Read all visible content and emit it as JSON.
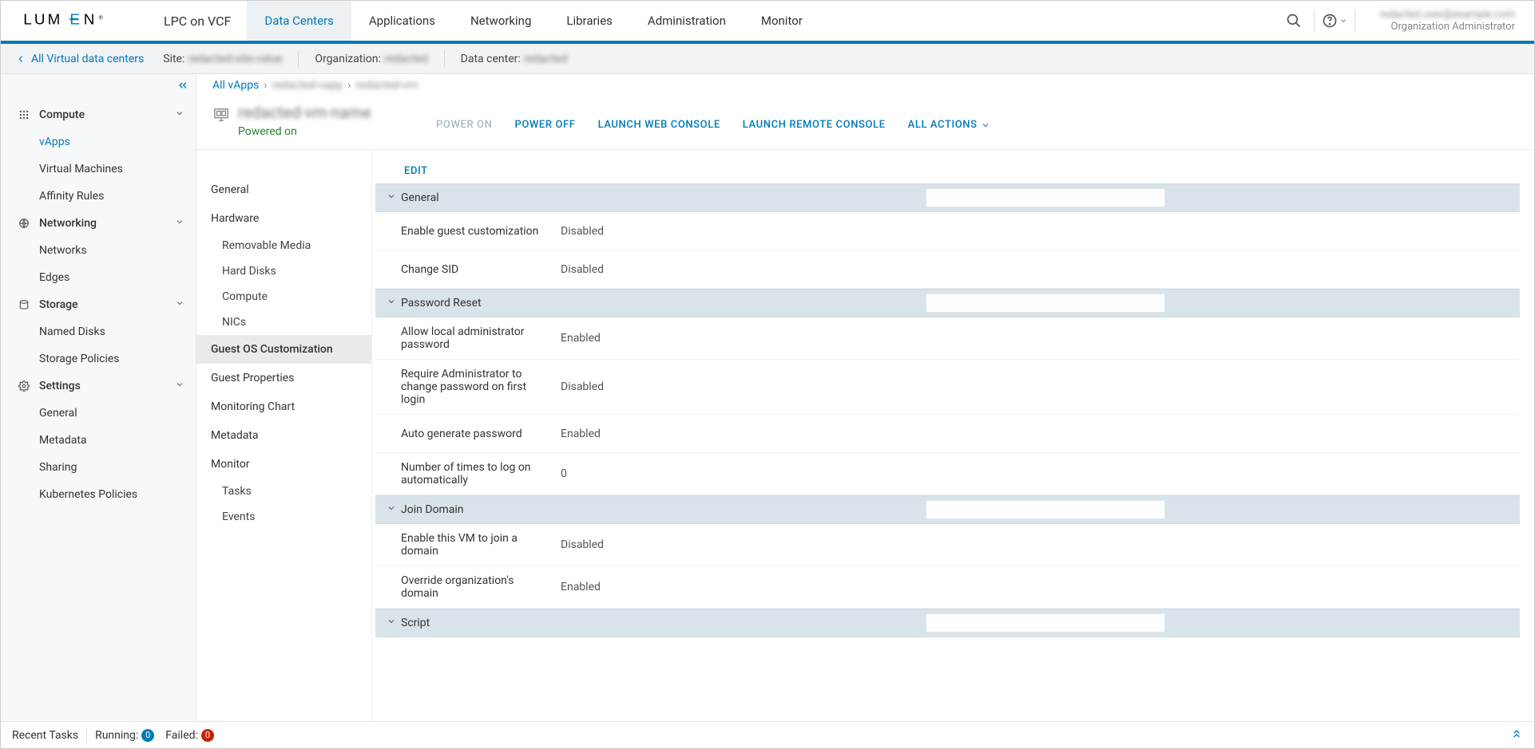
{
  "header": {
    "logo_text": "LUMEN",
    "product_name": "LPC on VCF",
    "nav": [
      "Data Centers",
      "Applications",
      "Networking",
      "Libraries",
      "Administration",
      "Monitor"
    ],
    "active_nav_index": 0,
    "user_email": "redacted.user@example.com",
    "user_role": "Organization Administrator"
  },
  "context_bar": {
    "back_label": "All Virtual data centers",
    "site_label": "Site:",
    "site_value": "redacted-site-value",
    "org_label": "Organization:",
    "org_value": "redacted",
    "dc_label": "Data center:",
    "dc_value": "redacted"
  },
  "sidebar": {
    "sections": [
      {
        "title": "Compute",
        "icon": "grid",
        "items": [
          "vApps",
          "Virtual Machines",
          "Affinity Rules"
        ],
        "active_item": "vApps"
      },
      {
        "title": "Networking",
        "icon": "network",
        "items": [
          "Networks",
          "Edges"
        ]
      },
      {
        "title": "Storage",
        "icon": "storage",
        "items": [
          "Named Disks",
          "Storage Policies"
        ]
      },
      {
        "title": "Settings",
        "icon": "gear",
        "items": [
          "General",
          "Metadata",
          "Sharing",
          "Kubernetes Policies"
        ]
      }
    ]
  },
  "breadcrumb": {
    "root": "All vApps",
    "level1": "redacted-vapp",
    "level2": "redacted-vm"
  },
  "vm": {
    "name": "redacted-vm-name",
    "status": "Powered on"
  },
  "actions": {
    "power_on": "POWER ON",
    "power_off": "POWER OFF",
    "launch_web": "LAUNCH WEB CONSOLE",
    "launch_remote": "LAUNCH REMOTE CONSOLE",
    "all_actions": "ALL ACTIONS"
  },
  "detail_nav": {
    "items": [
      {
        "label": "General",
        "type": "item"
      },
      {
        "label": "Hardware",
        "type": "item"
      },
      {
        "label": "Removable Media",
        "type": "sub"
      },
      {
        "label": "Hard Disks",
        "type": "sub"
      },
      {
        "label": "Compute",
        "type": "sub"
      },
      {
        "label": "NICs",
        "type": "sub"
      },
      {
        "label": "Guest OS Customization",
        "type": "item",
        "active": true
      },
      {
        "label": "Guest Properties",
        "type": "item"
      },
      {
        "label": "Monitoring Chart",
        "type": "item"
      },
      {
        "label": "Metadata",
        "type": "item"
      },
      {
        "label": "Monitor",
        "type": "item"
      },
      {
        "label": "Tasks",
        "type": "sub"
      },
      {
        "label": "Events",
        "type": "sub"
      }
    ]
  },
  "edit_label": "EDIT",
  "sections": [
    {
      "title": "General",
      "rows": [
        {
          "label": "Enable guest customization",
          "value": "Disabled"
        },
        {
          "label": "Change SID",
          "value": "Disabled"
        }
      ]
    },
    {
      "title": "Password Reset",
      "rows": [
        {
          "label": "Allow local administrator password",
          "value": "Enabled"
        },
        {
          "label": "Require Administrator to change password on first login",
          "value": "Disabled"
        },
        {
          "label": "Auto generate password",
          "value": "Enabled"
        },
        {
          "label": "Number of times to log on automatically",
          "value": "0"
        }
      ]
    },
    {
      "title": "Join Domain",
      "rows": [
        {
          "label": "Enable this VM to join a domain",
          "value": "Disabled"
        },
        {
          "label": "Override organization's domain",
          "value": "Enabled"
        }
      ]
    },
    {
      "title": "Script",
      "rows": []
    }
  ],
  "footer": {
    "recent_tasks": "Recent Tasks",
    "running_label": "Running:",
    "running_count": "0",
    "failed_label": "Failed:",
    "failed_count": "0"
  }
}
